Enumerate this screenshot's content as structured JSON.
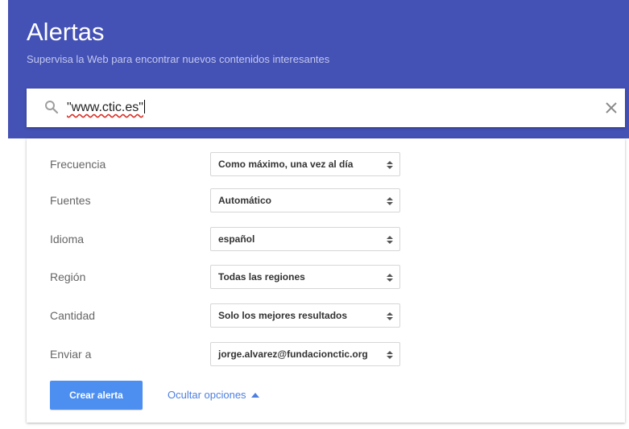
{
  "header": {
    "title": "Alertas",
    "subtitle": "Supervisa la Web para encontrar nuevos contenidos interesantes"
  },
  "search": {
    "value": "\"www.ctic.es\""
  },
  "options": [
    {
      "label": "Frecuencia",
      "value": "Como máximo, una vez al día"
    },
    {
      "label": "Fuentes",
      "value": "Automático"
    },
    {
      "label": "Idioma",
      "value": "español"
    },
    {
      "label": "Región",
      "value": "Todas las regiones"
    },
    {
      "label": "Cantidad",
      "value": "Solo los mejores resultados"
    },
    {
      "label": "Enviar a",
      "value": "jorge.alvarez@fundacionctic.org"
    }
  ],
  "actions": {
    "create_label": "Crear alerta",
    "toggle_label": "Ocultar opciones"
  },
  "colors": {
    "header_bg": "#4451b5",
    "primary_button": "#4d8ff0",
    "link": "#4d7fe0"
  }
}
